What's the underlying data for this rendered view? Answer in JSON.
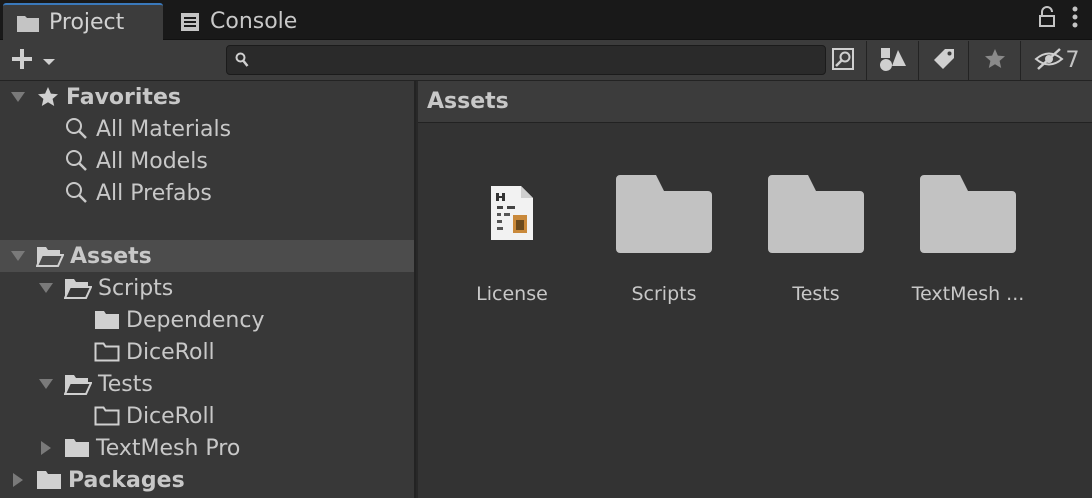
{
  "tabs": [
    {
      "label": "Project",
      "icon": "folder-icon",
      "active": true
    },
    {
      "label": "Console",
      "icon": "console-icon",
      "active": false
    }
  ],
  "toolbar": {
    "add_icon": "plus-icon",
    "search_value": "",
    "search_placeholder": "",
    "hidden_count": "7"
  },
  "tree": {
    "favorites": {
      "label": "Favorites",
      "items": [
        "All Materials",
        "All Models",
        "All Prefabs"
      ]
    },
    "assets": {
      "label": "Assets",
      "scripts": {
        "label": "Scripts",
        "children": [
          "Dependency",
          "DiceRoll"
        ]
      },
      "tests": {
        "label": "Tests",
        "children": [
          "DiceRoll"
        ]
      },
      "textmesh": {
        "label": "TextMesh Pro"
      }
    },
    "packages": {
      "label": "Packages"
    }
  },
  "browser": {
    "breadcrumb": "Assets",
    "items": [
      {
        "name": "License",
        "type": "text-asset"
      },
      {
        "name": "Scripts",
        "type": "folder"
      },
      {
        "name": "Tests",
        "type": "folder"
      },
      {
        "name": "TextMesh ...",
        "type": "folder"
      }
    ]
  },
  "colors": {
    "background": "#282828",
    "panel": "#383838",
    "selected_row": "#4c4c4c",
    "active_tab_accent": "#3a79bb",
    "folder_thumbnail": "#c2c2c2"
  }
}
